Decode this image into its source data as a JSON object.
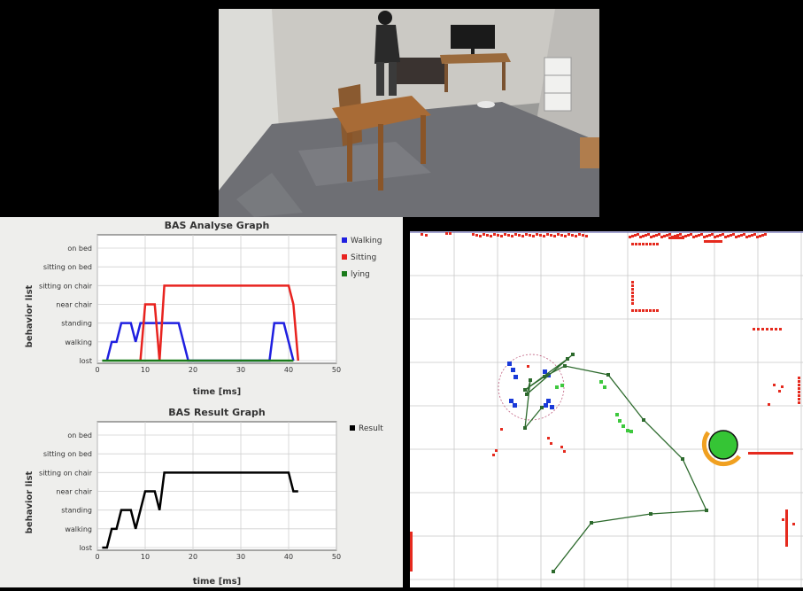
{
  "video": {
    "scene": "room-camera-feed",
    "colors": {
      "wall": "#c9c7c2",
      "floor": "#6f7075",
      "table": "#a56a34"
    }
  },
  "analyse_graph": {
    "title": "BAS Analyse Graph",
    "xlabel": "time [ms]",
    "ylabel": "behavior list",
    "legend": [
      "Walking",
      "Sitting",
      "lying"
    ]
  },
  "result_graph": {
    "title": "BAS Result Graph",
    "xlabel": "time [ms]",
    "ylabel": "behavior list",
    "legend": [
      "Result"
    ]
  },
  "chart_data": [
    {
      "type": "line",
      "title": "BAS Analyse Graph",
      "xlabel": "time [ms]",
      "ylabel": "behavior list",
      "xlim": [
        0,
        50
      ],
      "xticks": [
        0,
        10,
        20,
        30,
        40,
        50
      ],
      "categories": [
        "lost",
        "walking",
        "standing",
        "near chair",
        "sitting on chair",
        "sitting on bed",
        "on bed"
      ],
      "grid": true,
      "legend_position": "right",
      "series": [
        {
          "name": "Walking",
          "color": "#1f1fe0",
          "x": [
            2,
            3,
            4,
            5,
            7,
            8,
            9,
            10,
            13,
            17,
            19,
            36,
            37,
            39,
            41
          ],
          "y": [
            0,
            1,
            1,
            2,
            2,
            1,
            2,
            2,
            2,
            2,
            0,
            0,
            2,
            2,
            0
          ]
        },
        {
          "name": "Sitting",
          "color": "#e8231f",
          "x": [
            9,
            10,
            12,
            13,
            14,
            40,
            41,
            42
          ],
          "y": [
            0,
            3,
            3,
            0,
            4,
            4,
            3,
            0
          ]
        },
        {
          "name": "lying",
          "color": "#1a7a1a",
          "x": [
            1,
            41
          ],
          "y": [
            0,
            0
          ]
        }
      ]
    },
    {
      "type": "line",
      "title": "BAS Result Graph",
      "xlabel": "time [ms]",
      "ylabel": "behavior list",
      "xlim": [
        0,
        50
      ],
      "xticks": [
        0,
        10,
        20,
        30,
        40,
        50
      ],
      "categories": [
        "lost",
        "walking",
        "standing",
        "near chair",
        "sitting on chair",
        "sitting on bed",
        "on bed"
      ],
      "grid": true,
      "legend_position": "right",
      "series": [
        {
          "name": "Result",
          "color": "#000000",
          "x": [
            1,
            2,
            3,
            4,
            5,
            7,
            8,
            9,
            10,
            12,
            13,
            14,
            40,
            41,
            42
          ],
          "y": [
            0,
            0,
            1,
            1,
            2,
            2,
            1,
            2,
            3,
            3,
            2,
            4,
            4,
            3,
            3
          ]
        }
      ]
    }
  ],
  "map": {
    "colors": {
      "background": "#ffffff",
      "grid": "#c8c8c8",
      "laser": "#e52a1e",
      "track": "#2d6a2d",
      "person": "#35c535",
      "person_ring": "#f0a020",
      "legs": "#1a3ad8",
      "green_points": "#3ec83e"
    }
  }
}
